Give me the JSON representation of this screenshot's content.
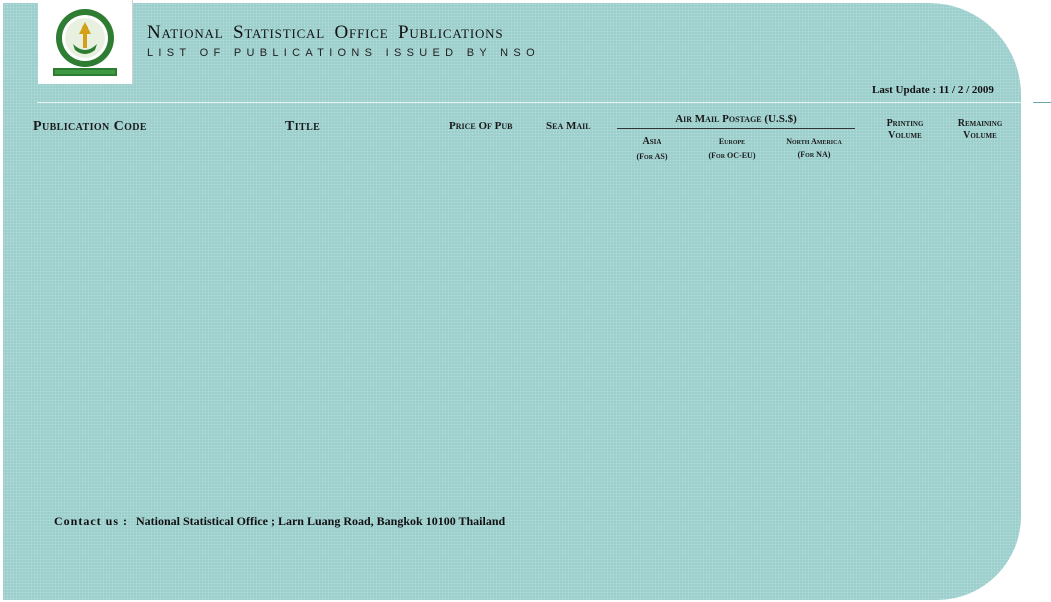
{
  "header": {
    "title": "National Statistical Office Publications",
    "subtitle": "LIST OF PUBLICATIONS ISSUED BY NSO",
    "last_update": "Last Update :  11 / 2 / 2009"
  },
  "logo": {
    "icon": "nso-emblem-icon",
    "colors": {
      "ring": "#2e7d32",
      "gold": "#d4a017",
      "inner": "#ffffff"
    }
  },
  "table_header": {
    "publication_code": "Publication Code",
    "title": "Title",
    "price_of_pub": "Price Of Pub",
    "sea_mail": "Sea Mail",
    "air_mail_postage": "Air Mail Postage  (U.S.$)",
    "asia": "Asia",
    "asia_sub": "(For AS)",
    "europe": "Europe",
    "europe_sub": "(For OC-EU)",
    "north_america": "North America",
    "north_america_sub": "(For NA)",
    "printing": "Printing",
    "printing_volume": "Volume",
    "remaining": "Remaining",
    "remaining_volume": "Volume"
  },
  "footer": {
    "contact_label": "Contact  us  :",
    "contact_text": "National Statistical Office ; Larn Luang Road,  Bangkok  10100   Thailand"
  },
  "colors": {
    "panel": "#9dcfcd",
    "rule": "#e9f5f5",
    "text": "#111111"
  }
}
